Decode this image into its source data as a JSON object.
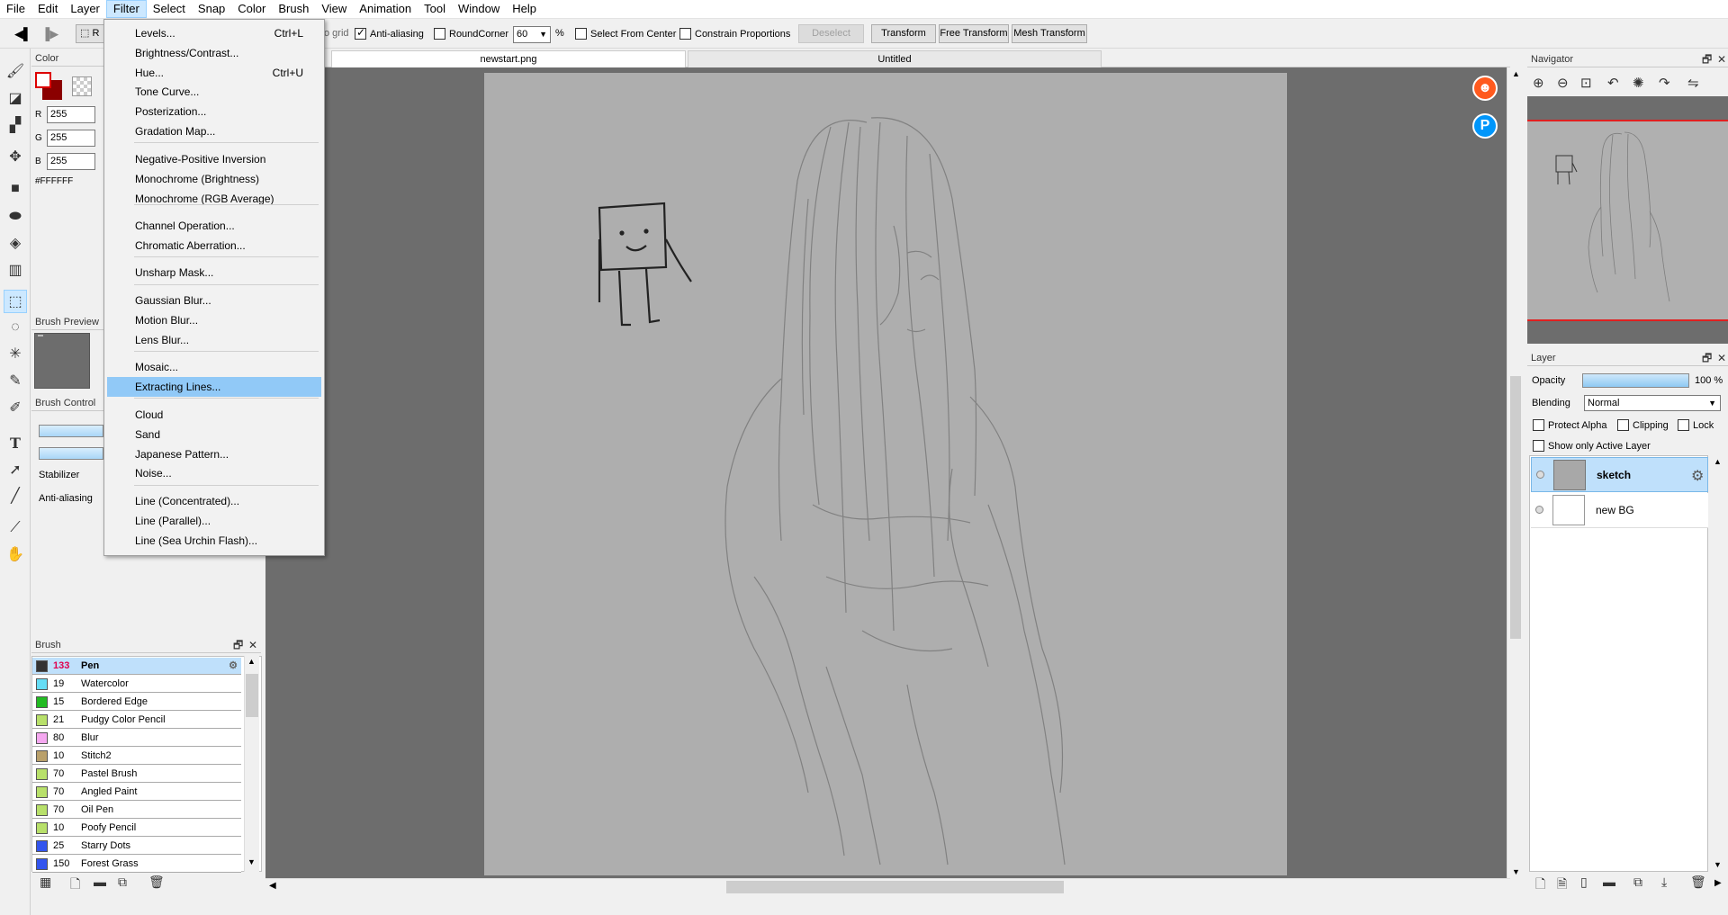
{
  "menubar": [
    {
      "label": "File"
    },
    {
      "label": "Edit"
    },
    {
      "label": "Layer"
    },
    {
      "label": "Filter"
    },
    {
      "label": "Select"
    },
    {
      "label": "Snap"
    },
    {
      "label": "Color"
    },
    {
      "label": "Brush"
    },
    {
      "label": "View"
    },
    {
      "label": "Animation"
    },
    {
      "label": "Tool"
    },
    {
      "label": "Window"
    },
    {
      "label": "Help"
    }
  ],
  "toolbar": {
    "grid_fragment": "o grid",
    "antialias": "Anti-aliasing",
    "roundcorner": "RoundCorner",
    "roundcorner_value": "60",
    "percent": "%",
    "select_from_center": "Select From Center",
    "constrain": "Constrain Proportions",
    "deselect": "Deselect",
    "transform": "Transform",
    "free_transform": "Free Transform",
    "mesh_transform": "Mesh Transform",
    "r_fragment": "R"
  },
  "filter_menu": {
    "items": [
      {
        "label": "Levels...",
        "shortcut": "Ctrl+L"
      },
      {
        "label": "Brightness/Contrast...",
        "shortcut": ""
      },
      {
        "label": "Hue...",
        "shortcut": "Ctrl+U"
      },
      {
        "label": "Tone Curve...",
        "shortcut": ""
      },
      {
        "label": "Posterization...",
        "shortcut": ""
      },
      {
        "label": "Gradation Map...",
        "shortcut": ""
      },
      {
        "label": "Negative-Positive Inversion",
        "shortcut": ""
      },
      {
        "label": "Monochrome (Brightness)",
        "shortcut": ""
      },
      {
        "label": "Monochrome (RGB Average)",
        "shortcut": ""
      },
      {
        "label": "Channel Operation...",
        "shortcut": ""
      },
      {
        "label": "Chromatic Aberration...",
        "shortcut": ""
      },
      {
        "label": "Unsharp Mask...",
        "shortcut": ""
      },
      {
        "label": "Gaussian Blur...",
        "shortcut": ""
      },
      {
        "label": "Motion Blur...",
        "shortcut": ""
      },
      {
        "label": "Lens Blur...",
        "shortcut": ""
      },
      {
        "label": "Mosaic...",
        "shortcut": ""
      },
      {
        "label": "Extracting Lines...",
        "shortcut": ""
      },
      {
        "label": "Cloud",
        "shortcut": ""
      },
      {
        "label": "Sand",
        "shortcut": ""
      },
      {
        "label": "Japanese Pattern...",
        "shortcut": ""
      },
      {
        "label": "Noise...",
        "shortcut": ""
      },
      {
        "label": "Line (Concentrated)...",
        "shortcut": ""
      },
      {
        "label": "Line (Parallel)...",
        "shortcut": ""
      },
      {
        "label": "Line (Sea Urchin Flash)...",
        "shortcut": ""
      }
    ]
  },
  "color_panel": {
    "title": "Color",
    "r_label": "R",
    "r_value": "255",
    "g_label": "G",
    "g_value": "255",
    "b_label": "B",
    "b_value": "255",
    "hex": "#FFFFFF"
  },
  "brush_preview": {
    "title": "Brush Preview"
  },
  "brush_control": {
    "title": "Brush Control",
    "stabilizer": "Stabilizer",
    "antialias": "Anti-aliasing"
  },
  "tabs": [
    {
      "label": "newstart.png"
    },
    {
      "label": "Untitled"
    }
  ],
  "brush_panel": {
    "title": "Brush",
    "items": [
      {
        "num": "133",
        "name": "Pen",
        "color": "#333333"
      },
      {
        "num": "19",
        "name": "Watercolor",
        "color": "#66ddf5"
      },
      {
        "num": "15",
        "name": "Bordered Edge",
        "color": "#22bb22"
      },
      {
        "num": "21",
        "name": "Pudgy Color Pencil",
        "color": "#b8e06a"
      },
      {
        "num": "80",
        "name": "Blur",
        "color": "#f5a8f0"
      },
      {
        "num": "10",
        "name": "Stitch2",
        "color": "#b9a06a"
      },
      {
        "num": "70",
        "name": "Pastel Brush",
        "color": "#b8e06a"
      },
      {
        "num": "70",
        "name": "Angled Paint",
        "color": "#b8e06a"
      },
      {
        "num": "70",
        "name": "Oil Pen",
        "color": "#b8e06a"
      },
      {
        "num": "10",
        "name": "Poofy Pencil",
        "color": "#b8e06a"
      },
      {
        "num": "25",
        "name": "Starry Dots",
        "color": "#3355ee"
      },
      {
        "num": "150",
        "name": "Forest Grass",
        "color": "#3355ee"
      }
    ]
  },
  "navigator": {
    "title": "Navigator"
  },
  "layer_panel": {
    "title": "Layer",
    "opacity_label": "Opacity",
    "opacity_value": "100 %",
    "opacity_level": 1.0,
    "blending_label": "Blending",
    "blending_value": "Normal",
    "protect_alpha": "Protect Alpha",
    "clipping": "Clipping",
    "lock": "Lock",
    "show_only_active": "Show only Active Layer",
    "layers": [
      {
        "name": "sketch"
      },
      {
        "name": "new BG"
      }
    ]
  },
  "accent": "#99d1ff"
}
